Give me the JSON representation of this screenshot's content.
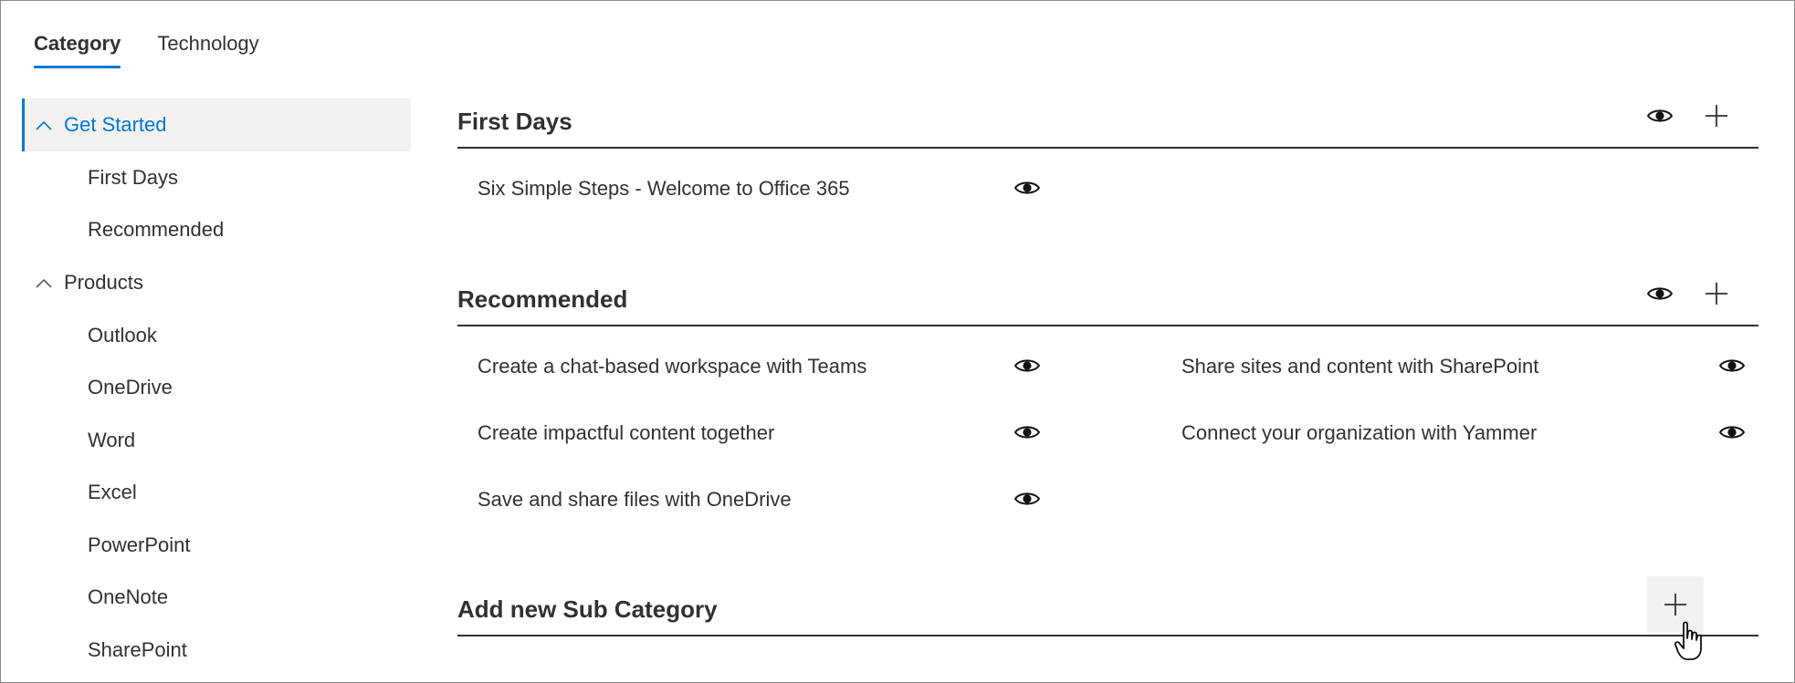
{
  "tabs": [
    {
      "label": "Category",
      "active": true
    },
    {
      "label": "Technology",
      "active": false
    }
  ],
  "sidebar": {
    "groups": [
      {
        "label": "Get Started",
        "expanded": true,
        "selected": true,
        "items": [
          {
            "label": "First Days"
          },
          {
            "label": "Recommended"
          }
        ]
      },
      {
        "label": "Products",
        "expanded": true,
        "selected": false,
        "items": [
          {
            "label": "Outlook"
          },
          {
            "label": "OneDrive"
          },
          {
            "label": "Word"
          },
          {
            "label": "Excel"
          },
          {
            "label": "PowerPoint"
          },
          {
            "label": "OneNote"
          },
          {
            "label": "SharePoint"
          }
        ]
      }
    ]
  },
  "sections": [
    {
      "title": "First Days",
      "items": [
        {
          "label": "Six Simple Steps - Welcome to Office 365"
        }
      ]
    },
    {
      "title": "Recommended",
      "items": [
        {
          "label": "Create a chat-based workspace with Teams"
        },
        {
          "label": "Share sites and content with SharePoint"
        },
        {
          "label": "Create impactful content together"
        },
        {
          "label": "Connect your organization with Yammer"
        },
        {
          "label": "Save and share files with OneDrive"
        }
      ]
    }
  ],
  "add_section": {
    "title": "Add new Sub Category"
  },
  "icons": {
    "visibility": "eye-icon",
    "add": "plus-icon",
    "collapse": "chevron-up-icon",
    "pointer": "hand-cursor-icon"
  },
  "colors": {
    "accent": "#0078d4",
    "selected_bg": "#f3f2f1",
    "text": "#323130"
  }
}
